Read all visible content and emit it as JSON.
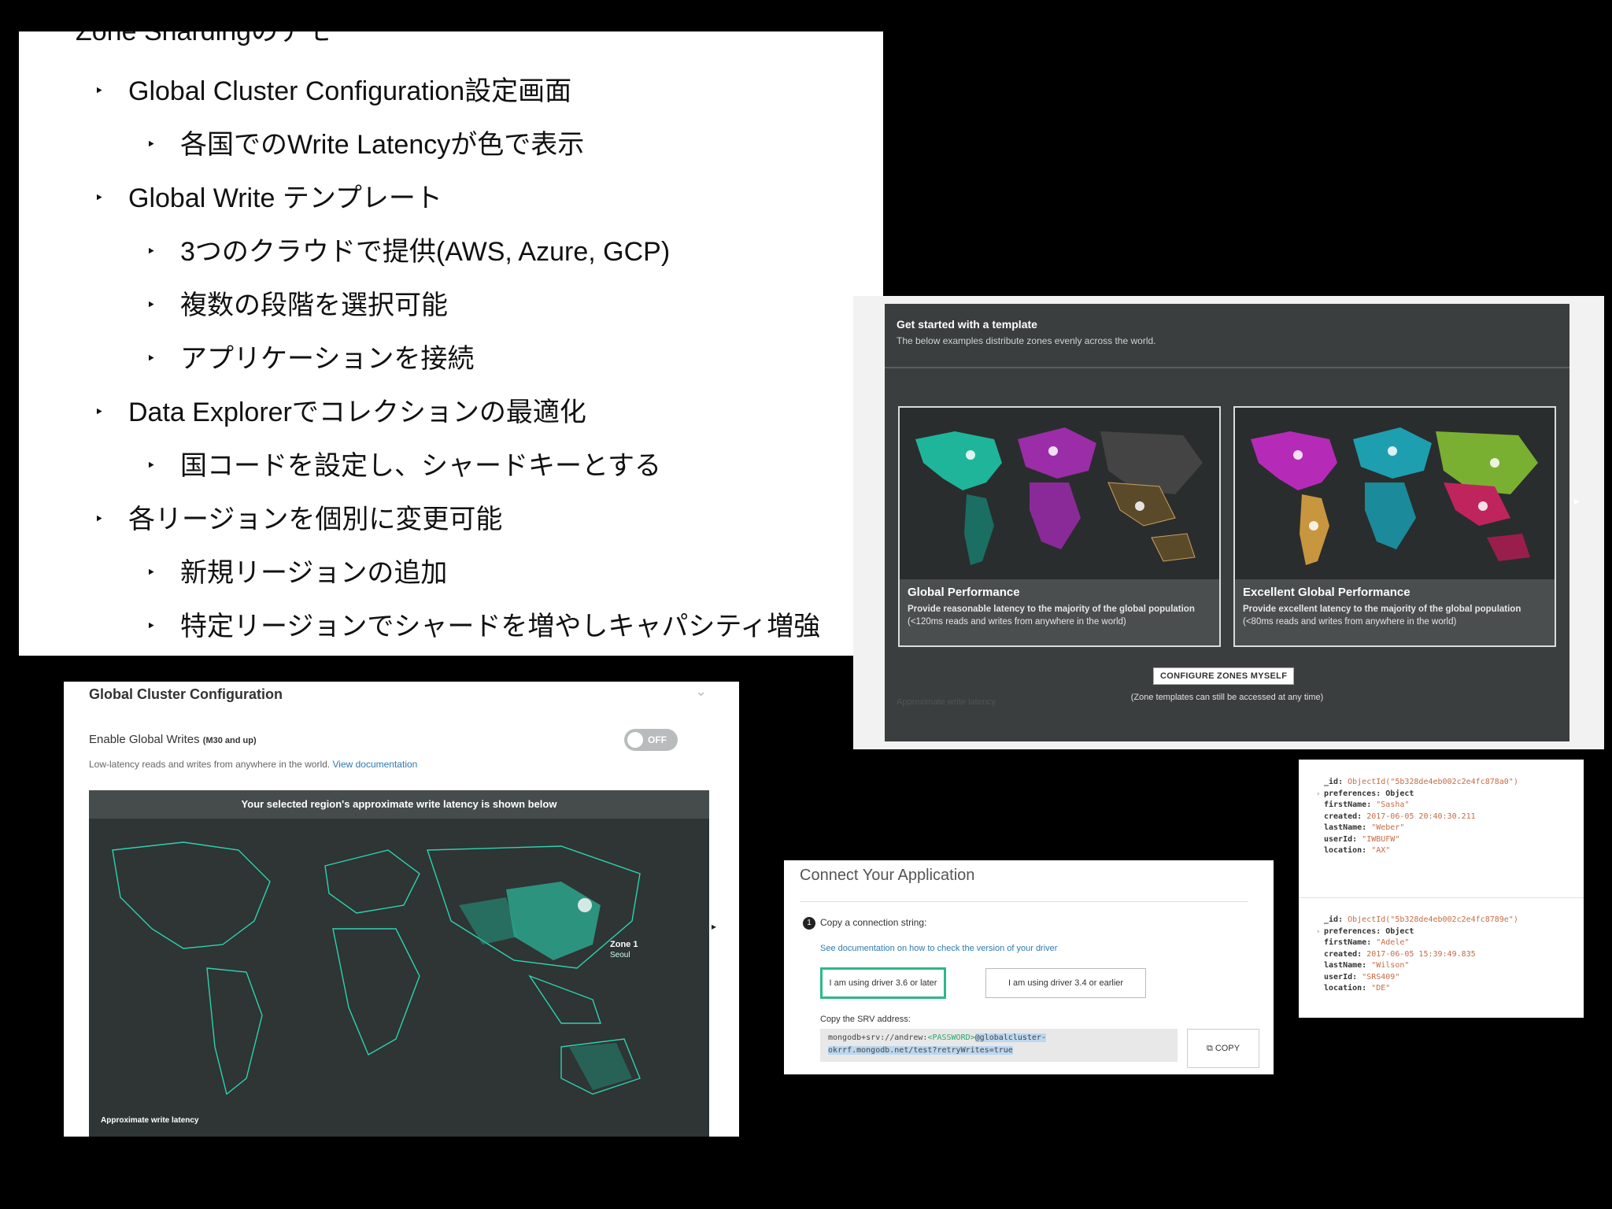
{
  "slide": {
    "heading": "Zone Shardingのデモ",
    "items": [
      {
        "level": 1,
        "text": "Global Cluster Configuration設定画面"
      },
      {
        "level": 2,
        "text": "各国でのWrite Latencyが色で表示"
      },
      {
        "level": 1,
        "text": "Global Write テンプレート"
      },
      {
        "level": 2,
        "text": "3つのクラウドで提供(AWS, Azure, GCP)"
      },
      {
        "level": 2,
        "text": "複数の段階を選択可能"
      },
      {
        "level": 2,
        "text": "アプリケーションを接続"
      },
      {
        "level": 1,
        "text": "Data Explorerでコレクションの最適化"
      },
      {
        "level": 2,
        "text": "国コードを設定し、シャードキーとする"
      },
      {
        "level": 1,
        "text": "各リージョンを個別に変更可能"
      },
      {
        "level": 2,
        "text": "新規リージョンの追加"
      },
      {
        "level": 2,
        "text": "特定リージョンでシャードを増やしキャパシティ増強"
      }
    ],
    "bullet": "‣"
  },
  "template_panel": {
    "title": "Get started with a template",
    "subtitle": "The below examples distribute zones evenly across the world.",
    "cards": [
      {
        "title": "Global Performance",
        "desc_bold": "Provide reasonable latency to the majority of the global population",
        "desc": "(<120ms reads and writes from anywhere in the world)"
      },
      {
        "title": "Excellent Global Performance",
        "desc_bold": "Provide excellent latency to the majority of the global population",
        "desc": "(<80ms reads and writes from anywhere in the world)"
      }
    ],
    "configure_button": "CONFIGURE ZONES MYSELF",
    "note": "(Zone templates can still be accessed at any time)",
    "ghost_label": "Approximate write latency"
  },
  "cluster_config": {
    "title": "Global Cluster Configuration",
    "enable_label": "Enable Global Writes",
    "enable_tier": "(M30 and up)",
    "toggle_state": "OFF",
    "description": "Low-latency reads and writes from anywhere in the world.",
    "doc_link": "View documentation",
    "map_header": "Your selected region's approximate write latency is shown below",
    "zone_name": "Zone 1",
    "zone_city": "Seoul",
    "latency_label": "Approximate write latency"
  },
  "connect": {
    "title": "Connect Your Application",
    "step_number": "1",
    "step_label": "Copy a connection string:",
    "doc_link": "See documentation on how to check the version of your driver",
    "driver_new": "I am using driver 3.6 or later",
    "driver_old": "I am using driver 3.4 or earlier",
    "srv_label": "Copy the SRV address:",
    "srv_prefix": "mongodb+srv://andrew:",
    "srv_password": "<PASSWORD>",
    "srv_host_line1": "@globalcluster-",
    "srv_host_line2": "okrrf.mongodb.net/test?retryWrites=true",
    "copy_label": "COPY"
  },
  "documents": [
    {
      "_id": "ObjectId(\"5b328de4eb002c2e4fc878a0\")",
      "preferences": "Object",
      "firstName": "\"Sasha\"",
      "created": "2017-06-05 20:40:30.211",
      "lastName": "\"Weber\"",
      "userId": "\"IWBUFW\"",
      "location": "\"AX\""
    },
    {
      "_id": "ObjectId(\"5b328de4eb002c2e4fc8789e\")",
      "preferences": "Object",
      "firstName": "\"Adele\"",
      "created": "2017-06-05 15:39:49.835",
      "lastName": "\"Wilson\"",
      "userId": "\"SRS409\"",
      "location": "\"DE\""
    }
  ],
  "doc_keys": [
    "_id",
    "preferences",
    "firstName",
    "created",
    "lastName",
    "userId",
    "location"
  ]
}
